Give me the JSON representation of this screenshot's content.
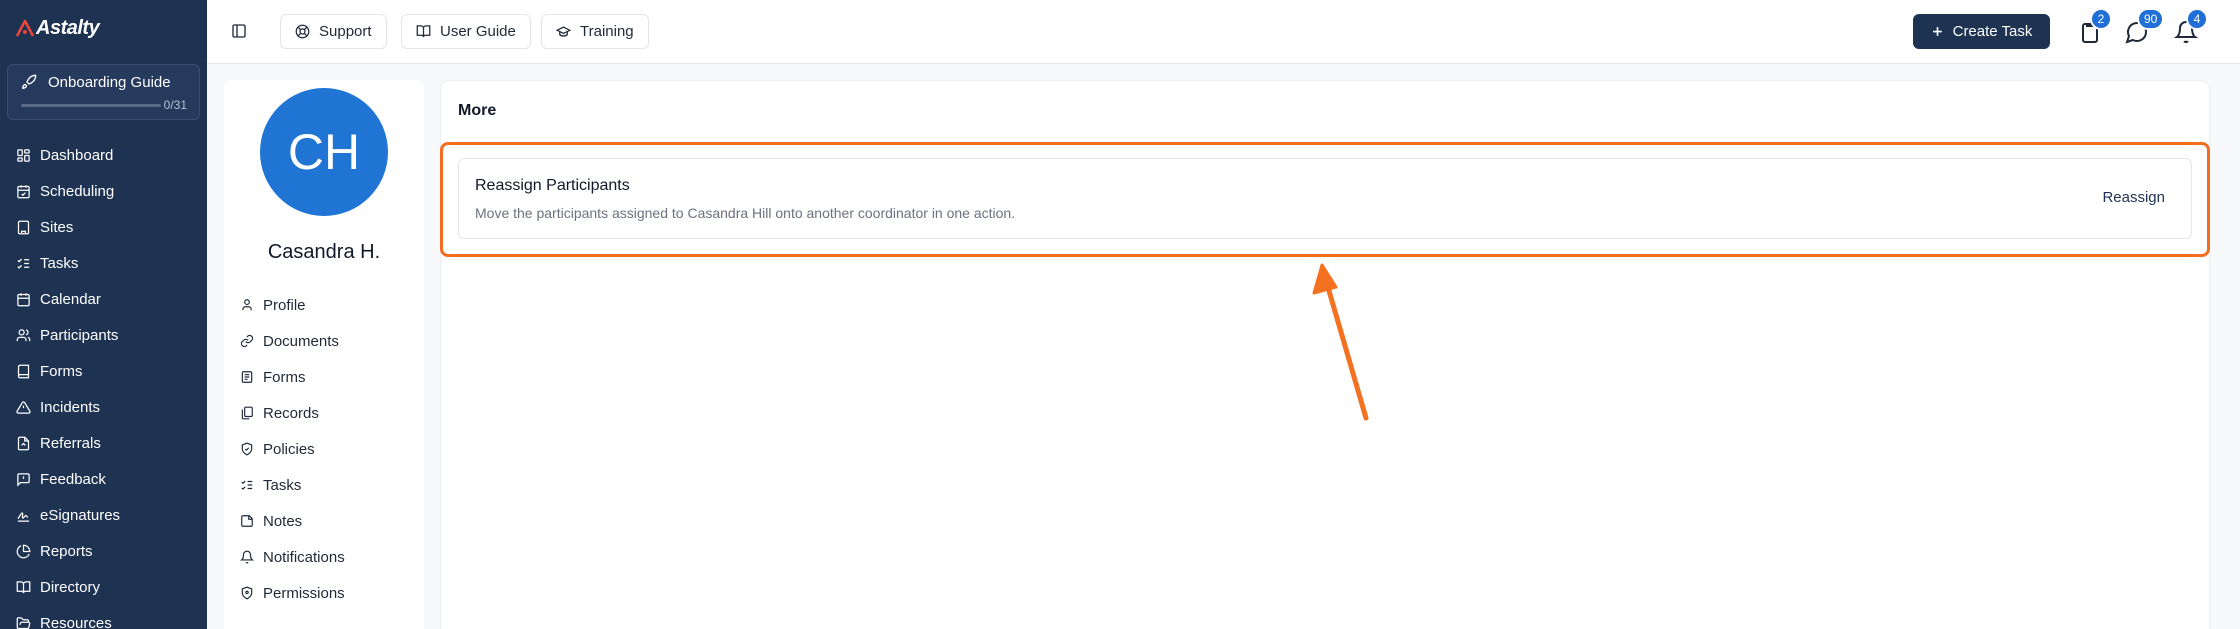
{
  "app": {
    "logo_text": "Astalty"
  },
  "sidebar": {
    "onboarding": {
      "label": "Onboarding Guide",
      "count": "0/31",
      "progress": 0
    },
    "items": [
      {
        "label": "Dashboard",
        "icon": "dashboard-icon"
      },
      {
        "label": "Scheduling",
        "icon": "calendar-check-icon"
      },
      {
        "label": "Sites",
        "icon": "building-icon"
      },
      {
        "label": "Tasks",
        "icon": "list-checks-icon"
      },
      {
        "label": "Calendar",
        "icon": "calendar-icon"
      },
      {
        "label": "Participants",
        "icon": "users-icon"
      },
      {
        "label": "Forms",
        "icon": "book-icon"
      },
      {
        "label": "Incidents",
        "icon": "triangle-alert-icon"
      },
      {
        "label": "Referrals",
        "icon": "file-import-icon"
      },
      {
        "label": "Feedback",
        "icon": "message-square-icon"
      },
      {
        "label": "eSignatures",
        "icon": "signature-icon"
      },
      {
        "label": "Reports",
        "icon": "chart-pie-icon"
      },
      {
        "label": "Directory",
        "icon": "book-open-icon"
      },
      {
        "label": "Resources",
        "icon": "folder-open-icon"
      }
    ]
  },
  "topbar": {
    "support_label": "Support",
    "user_guide_label": "User Guide",
    "training_label": "Training",
    "create_task_label": "Create Task",
    "badges": {
      "tasks": "2",
      "messages": "90",
      "notifications": "4"
    }
  },
  "profile": {
    "initials": "CH",
    "name": "Casandra H.",
    "menu": [
      {
        "label": "Profile",
        "icon": "user-icon"
      },
      {
        "label": "Documents",
        "icon": "link-icon"
      },
      {
        "label": "Forms",
        "icon": "form-icon"
      },
      {
        "label": "Records",
        "icon": "records-icon"
      },
      {
        "label": "Policies",
        "icon": "shield-check-icon"
      },
      {
        "label": "Tasks",
        "icon": "list-checks-icon"
      },
      {
        "label": "Notes",
        "icon": "note-icon"
      },
      {
        "label": "Notifications",
        "icon": "bell-icon"
      },
      {
        "label": "Permissions",
        "icon": "shield-lock-icon"
      }
    ]
  },
  "main": {
    "title": "More",
    "reassign": {
      "title": "Reassign Participants",
      "description": "Move the participants assigned to Casandra Hill onto another coordinator in one action.",
      "button_label": "Reassign"
    }
  },
  "colors": {
    "sidebar_bg": "#1e3252",
    "accent": "#1f74d4",
    "highlight": "#f36d1f"
  }
}
